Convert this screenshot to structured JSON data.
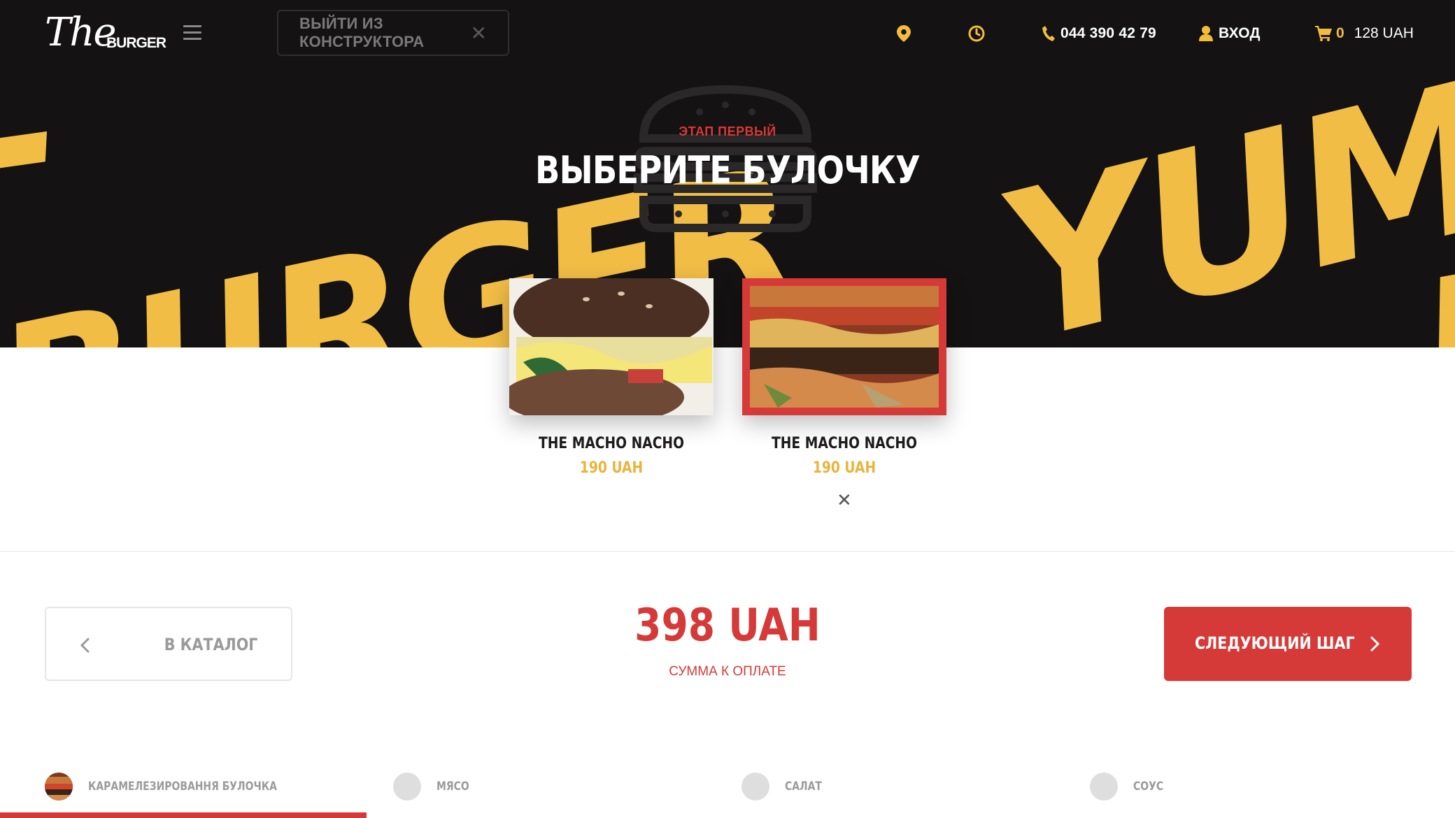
{
  "header": {
    "logo_script": "The",
    "logo_word": "BURGER",
    "exit_label": "ВЫЙТИ ИЗ КОНСТРУКТОРА",
    "phone": "044 390 42 79",
    "login": "ВХОД",
    "cart_count": "0",
    "cart_sum": "128 UAH"
  },
  "hero": {
    "decor_left": "BURGER",
    "decor_right": "YUM",
    "step_label": "ЭТАП ПЕРВЫЙ",
    "title": "ВЫБЕРИТЕ БУЛОЧКУ"
  },
  "products": [
    {
      "name": "THE MACHO NACHO",
      "price": "190 UAH",
      "selected": false
    },
    {
      "name": "THE MACHO NACHO",
      "price": "190 UAH",
      "selected": true
    }
  ],
  "footer_bar": {
    "back_label": "В КАТАЛОГ",
    "total": "398 UAH",
    "total_label": "СУММА К ОПЛАТЕ",
    "next_label": "СЛЕДУЮЩИЙ ШАГ"
  },
  "steps": [
    {
      "label": "КАРАМЕЛЕЗИРОВАННЯ БУЛОЧКА",
      "active": true
    },
    {
      "label": "МЯСО",
      "active": false
    },
    {
      "label": "САЛАТ",
      "active": false
    },
    {
      "label": "СОУС",
      "active": false
    }
  ],
  "colors": {
    "accent_red": "#d63a38",
    "accent_yellow": "#f1bd45",
    "hero_bg": "#141212"
  },
  "icons": [
    "menu-icon",
    "close-icon",
    "location-pin-icon",
    "clock-icon",
    "phone-icon",
    "user-icon",
    "cart-icon",
    "chevron-left-icon",
    "chevron-right-icon"
  ]
}
